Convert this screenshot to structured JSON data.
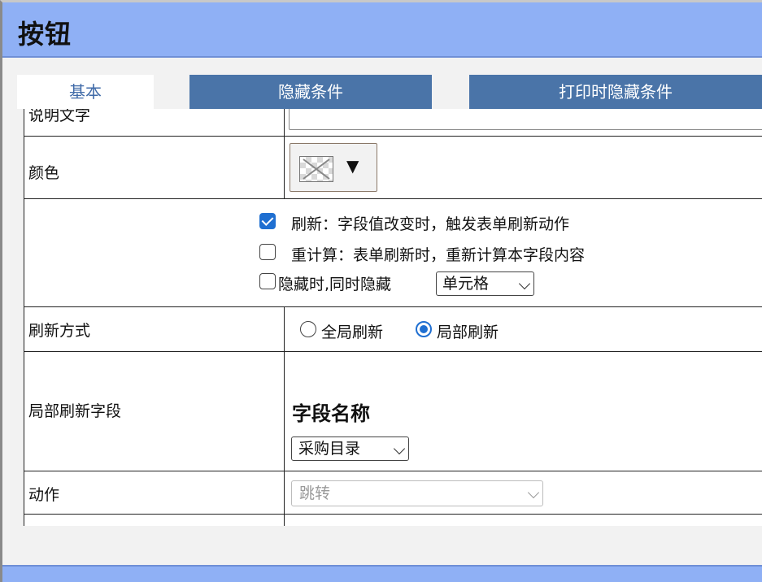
{
  "dialog": {
    "title": "按钮"
  },
  "tabs": [
    {
      "label": "基本",
      "active": true
    },
    {
      "label": "隐藏条件",
      "active": false
    },
    {
      "label": "打印时隐藏条件",
      "active": false
    }
  ],
  "rows": {
    "description": {
      "label": "说明文字",
      "value": ""
    },
    "color": {
      "label": "颜色",
      "dropdown_glyph": "▼"
    },
    "options": {
      "refresh": {
        "label": "刷新：字段值改变时，触发表单刷新动作",
        "checked": true
      },
      "recalc": {
        "label": "重计算：表单刷新时，重新计算本字段内容",
        "checked": false
      },
      "hide": {
        "label": "隐藏时,同时隐藏",
        "checked": false,
        "select_value": "单元格"
      }
    },
    "refresh_mode": {
      "label": "刷新方式",
      "choices": [
        {
          "label": "全局刷新",
          "selected": false
        },
        {
          "label": "局部刷新",
          "selected": true
        }
      ]
    },
    "partial_fields": {
      "label": "局部刷新字段",
      "heading": "字段名称",
      "select_value": "采购目录"
    },
    "action": {
      "label": "动作",
      "select_value": "跳转",
      "disabled": true
    }
  },
  "colors": {
    "title_bar": "#8fb0f5",
    "tab_inactive": "#4a74a8",
    "tab_active_text": "#3f6aa8",
    "accent": "#1f6fd1"
  }
}
